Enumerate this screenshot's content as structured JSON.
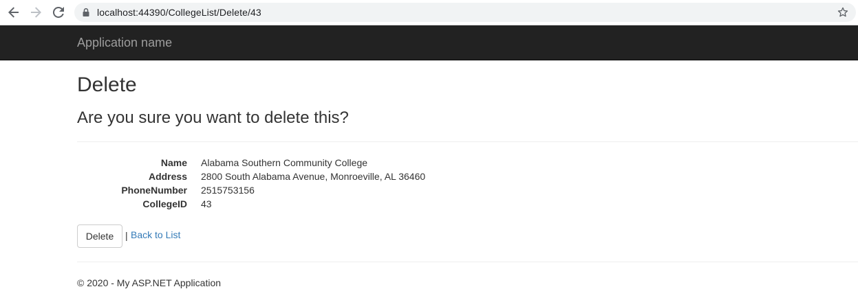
{
  "browser": {
    "url": "localhost:44390/CollegeList/Delete/43",
    "icons": {
      "back": "back-arrow-icon",
      "forward": "forward-arrow-icon",
      "reload": "reload-icon",
      "lock": "lock-icon",
      "bookmark": "star-icon"
    }
  },
  "navbar": {
    "brand": "Application name",
    "background": "#222222",
    "brand_color": "#9d9d9d"
  },
  "page": {
    "title": "Delete",
    "question": "Are you sure you want to delete this?",
    "fields": [
      {
        "label": "Name",
        "value": "Alabama Southern Community College"
      },
      {
        "label": "Address",
        "value": "2800 South Alabama Avenue, Monroeville, AL 36460"
      },
      {
        "label": "PhoneNumber",
        "value": "2515753156"
      },
      {
        "label": "CollegeID",
        "value": "43"
      }
    ],
    "delete_button": "Delete",
    "separator": "|",
    "back_link": "Back to List",
    "link_color": "#337ab7"
  },
  "footer": {
    "text": "© 2020 - My ASP.NET Application"
  }
}
